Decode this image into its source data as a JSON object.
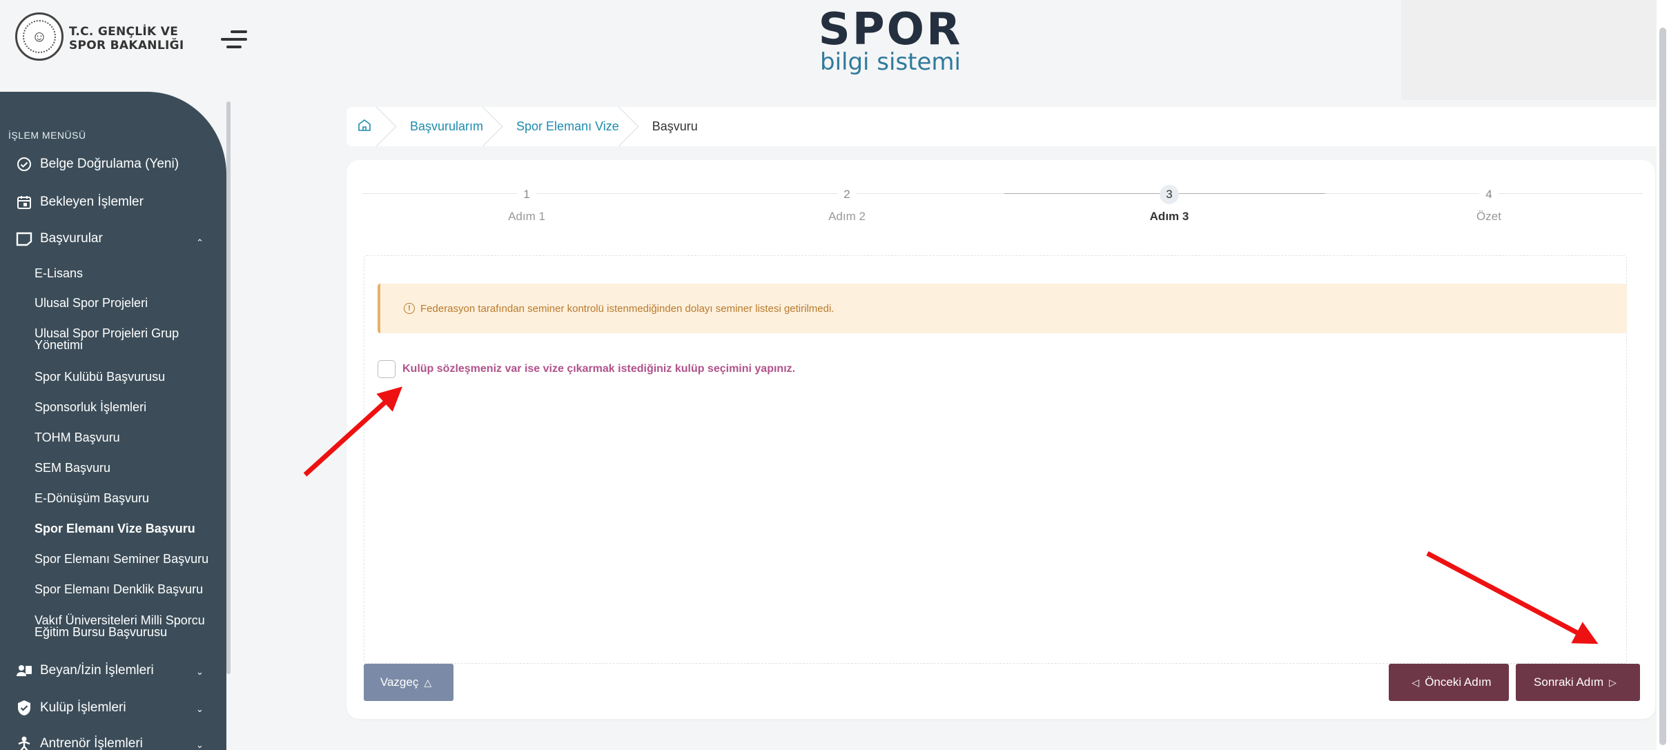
{
  "header": {
    "ministry_line1": "T.C. GENÇLİK VE",
    "ministry_line2": "SPOR BAKANLIĞI",
    "brand_title": "SPOR",
    "brand_subtitle": "bilgi sistemi"
  },
  "sidebar": {
    "menu_title": "İŞLEM MENÜSÜ",
    "items": [
      {
        "label": "Belge Doğrulama (Yeni)",
        "icon": "check-badge-icon"
      },
      {
        "label": "Bekleyen İşlemler",
        "icon": "calendar-icon"
      },
      {
        "label": "Başvurular",
        "icon": "document-icon",
        "expanded": true
      },
      {
        "label": "Beyan/İzin İşlemleri",
        "icon": "users-icon"
      },
      {
        "label": "Kulüp İşlemleri",
        "icon": "shield-icon"
      },
      {
        "label": "Antrenör İşlemleri",
        "icon": "trainer-icon"
      }
    ],
    "subitems": [
      {
        "label": "E-Lisans"
      },
      {
        "label": "Ulusal Spor Projeleri"
      },
      {
        "label": "Ulusal Spor Projeleri Grup Yönetimi"
      },
      {
        "label": "Spor Kulübü Başvurusu"
      },
      {
        "label": "Sponsorluk İşlemleri"
      },
      {
        "label": "TOHM Başvuru"
      },
      {
        "label": "SEM Başvuru"
      },
      {
        "label": "E-Dönüşüm Başvuru"
      },
      {
        "label": "Spor Elemanı Vize Başvuru",
        "active": true
      },
      {
        "label": "Spor Elemanı Seminer Başvuru"
      },
      {
        "label": "Spor Elemanı Denklik Başvuru"
      },
      {
        "label": "Vakıf Üniversiteleri Milli Sporcu Eğitim Bursu Başvurusu"
      }
    ]
  },
  "breadcrumb": {
    "items": [
      "Başvurularım",
      "Spor Elemanı Vize",
      "Başvuru"
    ]
  },
  "stepper": {
    "steps": [
      {
        "num": "1",
        "label": "Adım 1"
      },
      {
        "num": "2",
        "label": "Adım 2"
      },
      {
        "num": "3",
        "label": "Adım 3",
        "active": true
      },
      {
        "num": "4",
        "label": "Özet"
      }
    ]
  },
  "alert": {
    "text": "Federasyon tarafından seminer kontrolü istenmediğinden dolayı seminer listesi getirilmedi."
  },
  "checkbox": {
    "label": "Kulüp sözleşmeniz var ise vize çıkarmak istediğiniz kulüp seçimini yapınız.",
    "checked": false
  },
  "buttons": {
    "cancel": "Vazgeç",
    "prev": "Önceki Adım",
    "next": "Sonraki Adım"
  },
  "colors": {
    "sidebar_bg": "#3c4d59",
    "accent_link": "#1d8cad",
    "primary_button": "#6e3747",
    "cancel_button": "#7b8ba7",
    "alert_bg": "#fdf0dd",
    "alert_text": "#b97a2c",
    "check_label": "#b0528c",
    "annotation_arrow": "#ee1111"
  }
}
